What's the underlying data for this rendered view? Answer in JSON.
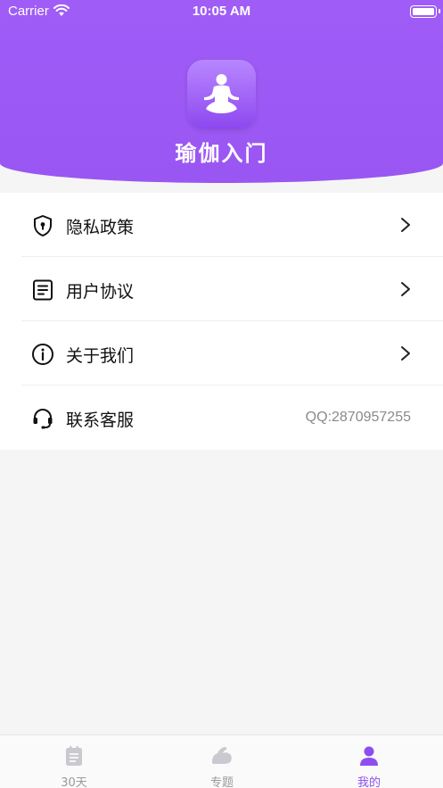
{
  "status_bar": {
    "carrier": "Carrier",
    "time": "10:05 AM"
  },
  "app": {
    "title": "瑜伽入门",
    "logo_icon": "yoga-lotus-icon"
  },
  "menu": [
    {
      "icon": "shield-icon",
      "label": "隐私政策",
      "chevron": true
    },
    {
      "icon": "document-icon",
      "label": "用户协议",
      "chevron": true
    },
    {
      "icon": "info-icon",
      "label": "关于我们",
      "chevron": true
    },
    {
      "icon": "headset-icon",
      "label": "联系客服",
      "value": "QQ:2870957255"
    }
  ],
  "tabbar": {
    "tabs": [
      {
        "icon": "calendar-icon",
        "label": "30天",
        "active": false
      },
      {
        "icon": "arm-muscle-icon",
        "label": "专题",
        "active": false
      },
      {
        "icon": "person-icon",
        "label": "我的",
        "active": true
      }
    ]
  },
  "colors": {
    "accent": "#8d4ef0",
    "header": "#9d59f4",
    "background": "#f5f5f5",
    "inactive": "#9a9a9a"
  }
}
